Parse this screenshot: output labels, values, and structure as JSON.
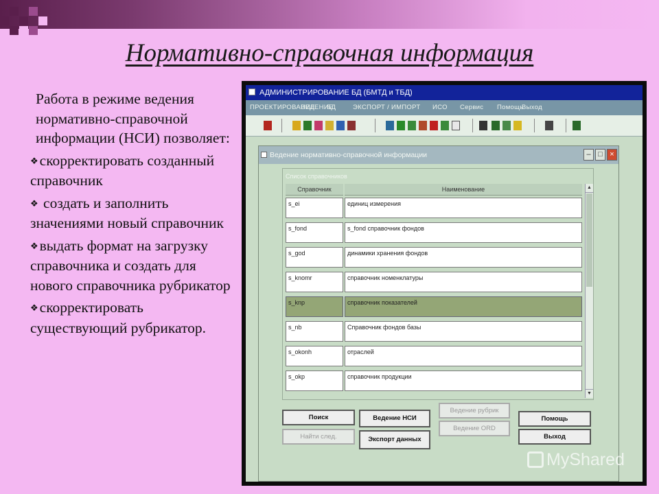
{
  "slide": {
    "title": "Нормативно-справочная информация",
    "intro": "Работа в режиме ведения нормативно-справочной информации (НСИ) позволяет:",
    "bullets": [
      "скорректировать созданный справочник",
      "создать и заполнить значениями новый справочник",
      "выдать формат на загрузку справочника и создать для нового справочника рубрикатор",
      "скорректировать существующий рубрикатор."
    ],
    "bullet_marker": "❖"
  },
  "app": {
    "title": "АДМИНИСТРИРОВАНИЕ БД  (БМТД и ТБД)",
    "menu": [
      "ПРОЕКТИРОВАНИЕ",
      "ВЕДЕНИЕ",
      "БД",
      "ЭКСПОРТ / ИМПОРТ",
      "ИСО",
      "Сервис",
      "Помощь",
      "Выход"
    ]
  },
  "dialog": {
    "title": "Ведение нормативно-справочной информации",
    "group_label": "Список справочников",
    "columns": [
      "Справочник",
      "Наименование"
    ],
    "rows": [
      {
        "code": "s_ei",
        "name": "единиц измерения"
      },
      {
        "code": "s_fond",
        "name": "s_fond справочник фондов"
      },
      {
        "code": "s_god",
        "name": "динамики хранения фондов"
      },
      {
        "code": "s_knomr",
        "name": "справочник номенклатуры"
      },
      {
        "code": "s_knp",
        "name": "справочник показателей"
      },
      {
        "code": "s_nb",
        "name": "Справочник фондов базы"
      },
      {
        "code": "s_okonh",
        "name": "отраслей"
      },
      {
        "code": "s_okp",
        "name": "справочник продукции"
      }
    ],
    "selected_row": 4,
    "buttons": {
      "search": "Поиск",
      "find_next": "Найти след.",
      "nsi": "Ведение НСИ",
      "export": "Экспорт данных",
      "rubrics": "Ведение рубрик",
      "ord": "Ведение ORD",
      "help": "Помощь",
      "exit": "Выход"
    }
  },
  "watermark": "MyShared"
}
